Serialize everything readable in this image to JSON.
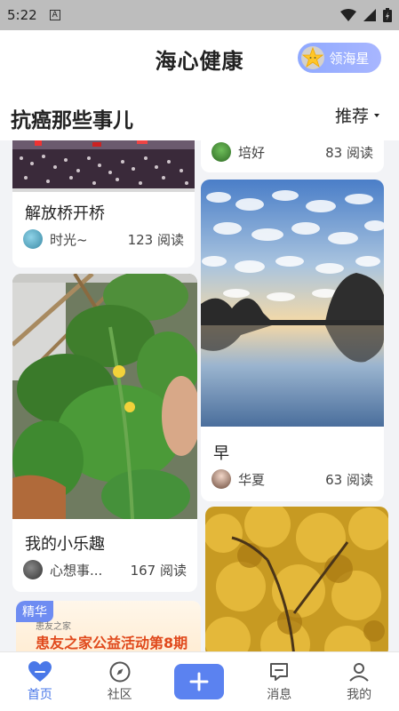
{
  "status_bar": {
    "time": "5:22",
    "sim_label": "A"
  },
  "header": {
    "title": "海心健康",
    "star_button": "领海星"
  },
  "subheader": {
    "topic": "抗癌那些事儿",
    "sort": "推荐"
  },
  "feed": {
    "left": [
      {
        "title": "解放桥开桥",
        "author": "时光~",
        "reads": "123 阅读"
      },
      {
        "title": "我的小乐趣",
        "author": "心想事...",
        "reads": "167 阅读"
      },
      {
        "badge": "精华",
        "banner_text": "患友之家公益活动第8期",
        "banner_brand": "患友之家"
      }
    ],
    "right": [
      {
        "author": "培好",
        "reads": "83 阅读"
      },
      {
        "title": "早",
        "author": "华夏",
        "reads": "63 阅读"
      },
      {}
    ]
  },
  "tabs": [
    {
      "label": "首页",
      "icon": "heart-icon",
      "active": true
    },
    {
      "label": "社区",
      "icon": "compass-icon"
    },
    {
      "label": "",
      "icon": "plus-icon"
    },
    {
      "label": "消息",
      "icon": "message-icon"
    },
    {
      "label": "我的",
      "icon": "user-icon"
    }
  ],
  "colors": {
    "accent": "#4a78e8",
    "plus_button": "#5b82f0",
    "badge": "#6e8cf2"
  }
}
